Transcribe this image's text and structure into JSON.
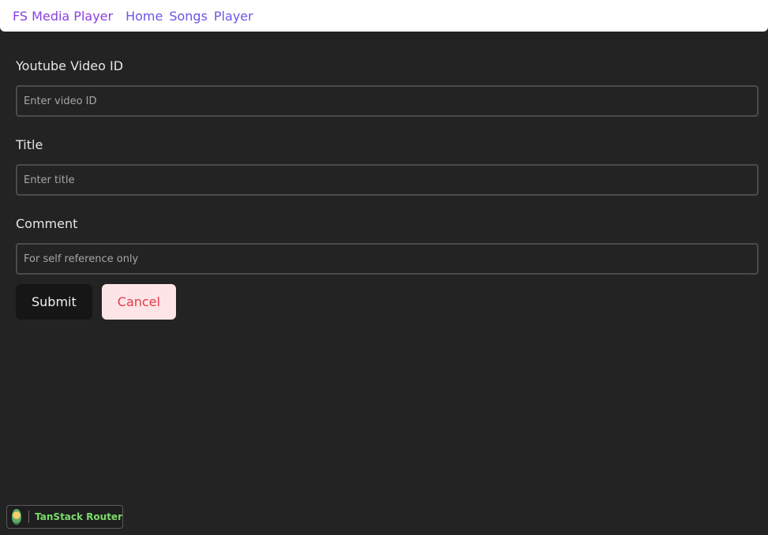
{
  "header": {
    "brand": "FS Media Player",
    "nav": [
      {
        "label": "Home"
      },
      {
        "label": "Songs"
      },
      {
        "label": "Player"
      }
    ]
  },
  "form": {
    "video_id": {
      "label": "Youtube Video ID",
      "value": "",
      "placeholder": "Enter video ID"
    },
    "title": {
      "label": "Title",
      "value": "",
      "placeholder": "Enter title"
    },
    "comment": {
      "label": "Comment",
      "value": "",
      "placeholder": "For self reference only"
    },
    "submit_label": "Submit",
    "cancel_label": "Cancel"
  },
  "devtools": {
    "label": "TanStack Router",
    "logo_icon": "tanstack-logo-icon"
  },
  "colors": {
    "background": "#232323",
    "brand": "#8b3fe0",
    "nav_link": "#6a55e8",
    "submit_bg": "#161616",
    "cancel_bg": "#fde4e6",
    "cancel_text": "#e63b4a",
    "badge_text": "#7cdb6a"
  }
}
